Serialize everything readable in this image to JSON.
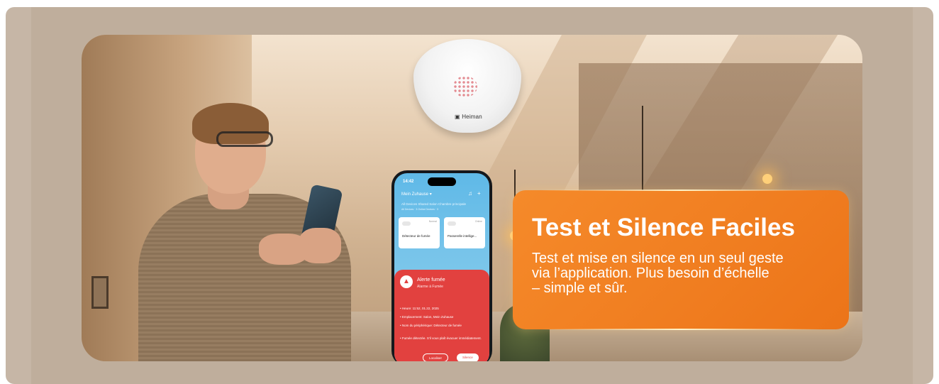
{
  "banner": {
    "title": "Test et Silence Faciles",
    "description_line1": "Test et mise en silence en un seul geste",
    "description_line2": "via l’application. Plus besoin d’échelle",
    "description_line3": "– simple et sûr."
  },
  "detector": {
    "brand": "Heiman"
  },
  "phone_app": {
    "time": "14:42",
    "home": "Mein Zuhause ▾",
    "tabs": "All Devices   Shared   Salon   Chambre principale",
    "subtabs": "All Devices · 3     Online Devices · 3",
    "cards": [
      {
        "status": "Normal",
        "name": "Détecteur de fumée"
      },
      {
        "status": "Online",
        "name": "Passerelle intellige..."
      }
    ],
    "alert": {
      "title": "Alerte fumée",
      "subtitle": "Alarme à Fumée",
      "lines": [
        "Heure: 11:52, 01.22, 2025",
        "Emplacement: Salon, Mein Zuhause",
        "Nom du périphérique: Détecteur de fumée",
        "Fumée détectée. S’il vous plaît évacuer immédiatement."
      ],
      "locate_button": "Localiser",
      "silence_button": "Silence"
    }
  },
  "colors": {
    "accent": "#F07D20",
    "background": "#BFAE9C",
    "alert": "#E2413F"
  },
  "icons": [
    "bell-icon",
    "plus-icon",
    "fire-icon"
  ]
}
